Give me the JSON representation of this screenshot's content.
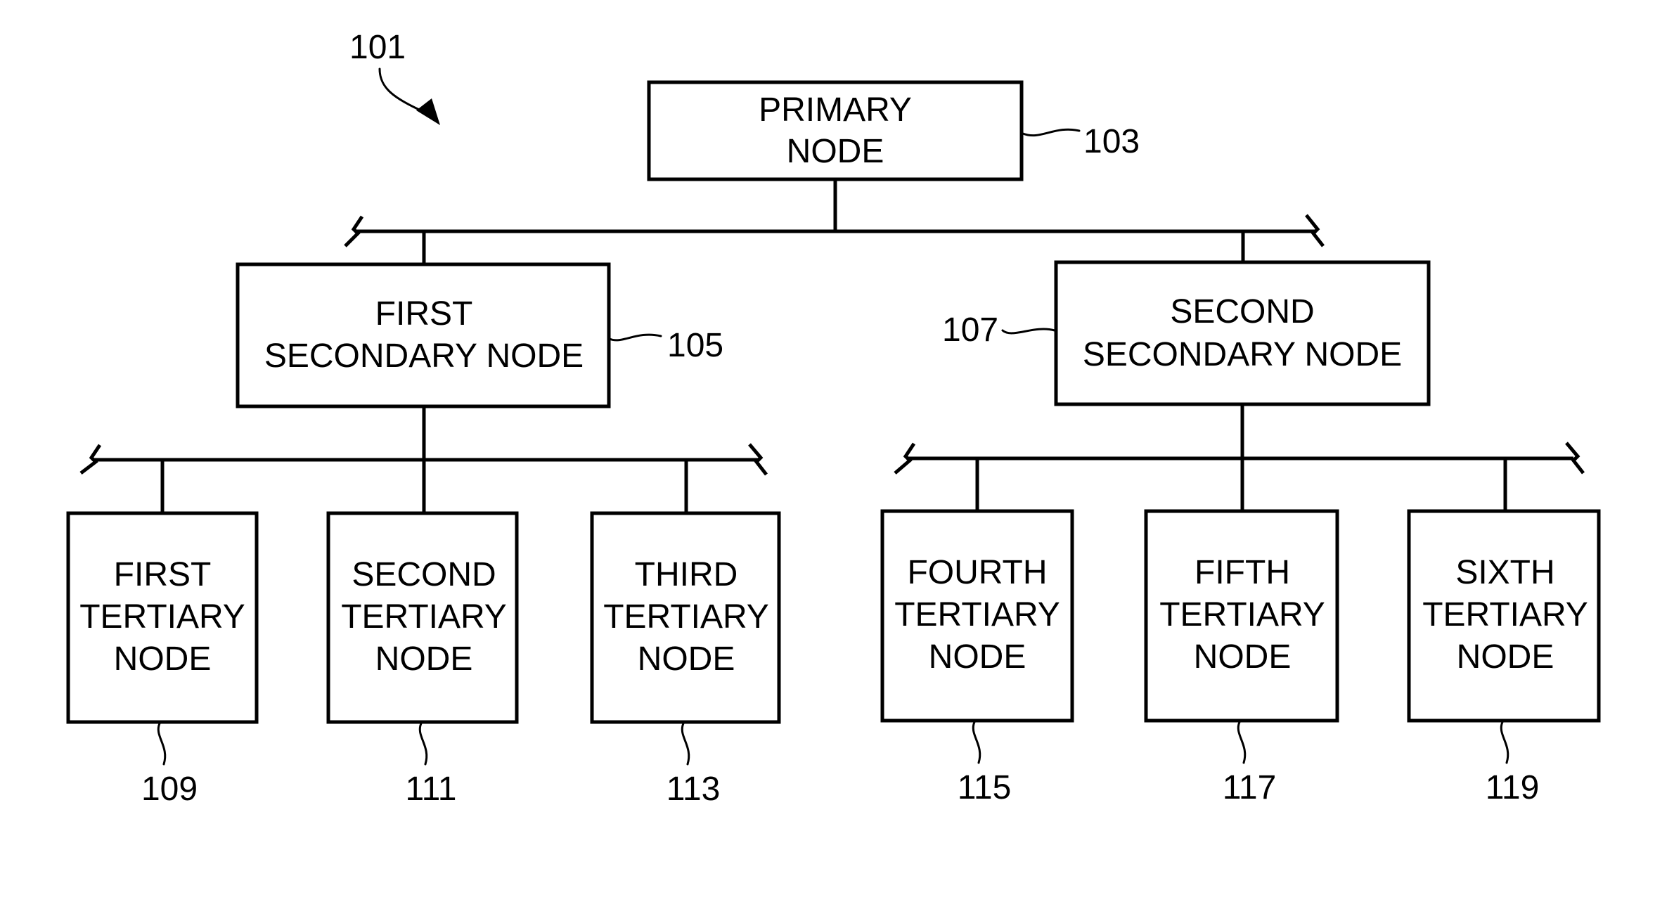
{
  "figure": {
    "reference": "101",
    "primary": {
      "id": "primary",
      "lines": [
        "PRIMARY",
        "NODE"
      ],
      "ref": "103"
    },
    "secondary": [
      {
        "id": "first-secondary",
        "lines": [
          "FIRST",
          "SECONDARY NODE"
        ],
        "ref": "105"
      },
      {
        "id": "second-secondary",
        "lines": [
          "SECOND",
          "SECONDARY NODE"
        ],
        "ref": "107"
      }
    ],
    "tertiary": [
      {
        "id": "first-tertiary",
        "parent": "first-secondary",
        "lines": [
          "FIRST",
          "TERTIARY",
          "NODE"
        ],
        "ref": "109"
      },
      {
        "id": "second-tertiary",
        "parent": "first-secondary",
        "lines": [
          "SECOND",
          "TERTIARY",
          "NODE"
        ],
        "ref": "111"
      },
      {
        "id": "third-tertiary",
        "parent": "first-secondary",
        "lines": [
          "THIRD",
          "TERTIARY",
          "NODE"
        ],
        "ref": "113"
      },
      {
        "id": "fourth-tertiary",
        "parent": "second-secondary",
        "lines": [
          "FOURTH",
          "TERTIARY",
          "NODE"
        ],
        "ref": "115"
      },
      {
        "id": "fifth-tertiary",
        "parent": "second-secondary",
        "lines": [
          "FIFTH",
          "TERTIARY",
          "NODE"
        ],
        "ref": "117"
      },
      {
        "id": "sixth-tertiary",
        "parent": "second-secondary",
        "lines": [
          "SIXTH",
          "TERTIARY",
          "NODE"
        ],
        "ref": "119"
      }
    ],
    "colors": {
      "stroke": "#000000",
      "background": "#ffffff"
    }
  }
}
